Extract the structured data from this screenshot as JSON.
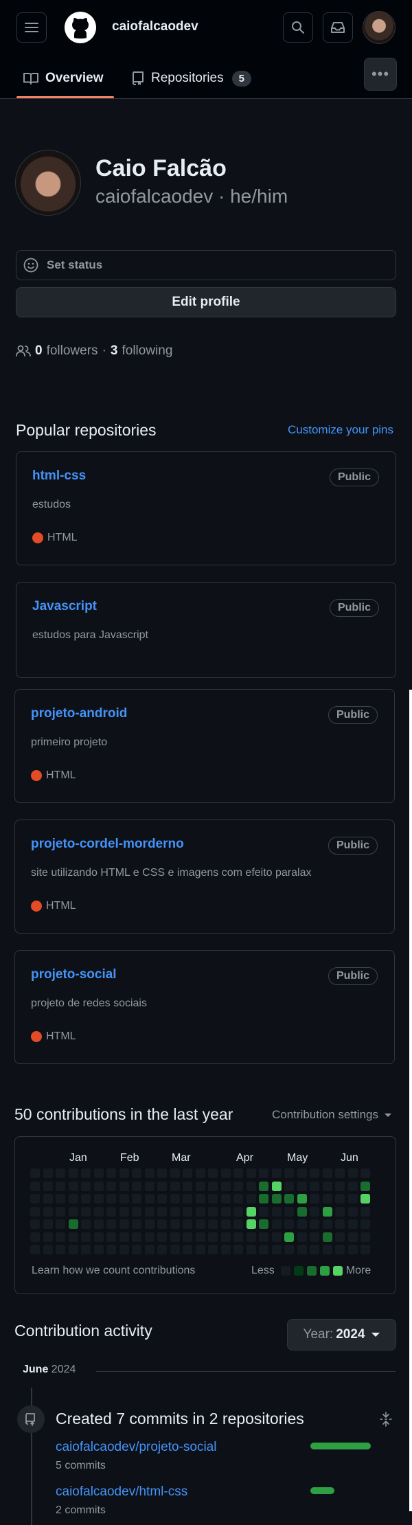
{
  "header": {
    "username": "caiofalcaodev",
    "tabs": [
      {
        "label": "Overview"
      },
      {
        "label": "Repositories",
        "count": "5"
      }
    ]
  },
  "profile": {
    "name": "Caio Falcão",
    "login_pronouns": "caiofalcaodev · he/him",
    "set_status": "Set status",
    "edit_profile": "Edit profile",
    "followers_count": "0",
    "followers_label": "followers",
    "separator": "·",
    "following_count": "3",
    "following_label": "following"
  },
  "popular": {
    "title": "Popular repositories",
    "customize": "Customize your pins",
    "repos": [
      {
        "name": "html-css",
        "visibility": "Public",
        "description": "estudos",
        "language": "HTML"
      },
      {
        "name": "Javascript",
        "visibility": "Public",
        "description": "estudos para Javascript",
        "language": ""
      },
      {
        "name": "projeto-android",
        "visibility": "Public",
        "description": "primeiro projeto",
        "language": "HTML"
      },
      {
        "name": "projeto-cordel-morderno",
        "visibility": "Public",
        "description": "site utilizando HTML e CSS e imagens com efeito paralax",
        "language": "HTML"
      },
      {
        "name": "projeto-social",
        "visibility": "Public",
        "description": "projeto de redes sociais",
        "language": "HTML"
      }
    ],
    "language_color": "#e34c26"
  },
  "contributions": {
    "title": "50 contributions in the last year",
    "settings": "Contribution settings",
    "months": [
      "Jan",
      "Feb",
      "Mar",
      "Apr",
      "May",
      "Jun"
    ],
    "learn": "Learn how we count contributions",
    "less": "Less",
    "more": "More",
    "level_colors": [
      "#151b23",
      "#033a16",
      "#196c2e",
      "#2ea043",
      "#56d364"
    ],
    "weeks": 27,
    "active_cells": [
      {
        "week": 3,
        "day": 4,
        "level": 2
      },
      {
        "week": 17,
        "day": 3,
        "level": 4
      },
      {
        "week": 17,
        "day": 4,
        "level": 4
      },
      {
        "week": 18,
        "day": 1,
        "level": 2
      },
      {
        "week": 18,
        "day": 2,
        "level": 2
      },
      {
        "week": 18,
        "day": 4,
        "level": 2
      },
      {
        "week": 19,
        "day": 1,
        "level": 4
      },
      {
        "week": 19,
        "day": 2,
        "level": 2
      },
      {
        "week": 20,
        "day": 2,
        "level": 2
      },
      {
        "week": 20,
        "day": 5,
        "level": 3
      },
      {
        "week": 21,
        "day": 2,
        "level": 3
      },
      {
        "week": 21,
        "day": 3,
        "level": 2
      },
      {
        "week": 23,
        "day": 3,
        "level": 3
      },
      {
        "week": 23,
        "day": 5,
        "level": 2
      },
      {
        "week": 26,
        "day": 1,
        "level": 2
      },
      {
        "week": 26,
        "day": 2,
        "level": 4
      }
    ]
  },
  "activity": {
    "title": "Contribution activity",
    "year_label": "Year:",
    "year_value": "2024",
    "month": "June",
    "month_year": "2024",
    "created": "Created 7 commits in 2 repositories",
    "items": [
      {
        "repo": "caiofalcaodev/projeto-social",
        "commits": "5 commits",
        "share": 1.0
      },
      {
        "repo": "caiofalcaodev/html-css",
        "commits": "2 commits",
        "share": 0.4
      }
    ]
  }
}
